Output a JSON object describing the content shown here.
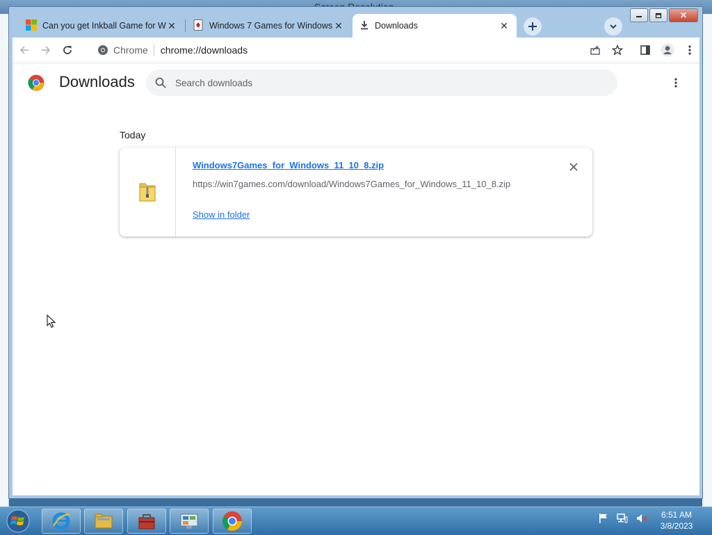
{
  "background_window": {
    "title": "Screen Resolution"
  },
  "tabs": [
    {
      "title": "Can you get Inkball Game for Wi",
      "active": false
    },
    {
      "title": "Windows 7 Games for Windows",
      "active": false
    },
    {
      "title": "Downloads",
      "active": true
    }
  ],
  "toolbar": {
    "chip_label": "Chrome",
    "url": "chrome://downloads"
  },
  "downloads_page": {
    "title": "Downloads",
    "search_placeholder": "Search downloads",
    "date_group": "Today",
    "item": {
      "filename": "Windows7Games_for_Windows_11_10_8.zip",
      "url": "https://win7games.com/download/Windows7Games_for_Windows_11_10_8.zip",
      "show_in_folder": "Show in folder"
    }
  },
  "taskbar": {
    "time": "6:51 AM",
    "date": "3/8/2023"
  },
  "colors": {
    "accent": "#1a73e8",
    "frame": "#a9c8e6",
    "taskbar": "#2f6fa6"
  }
}
